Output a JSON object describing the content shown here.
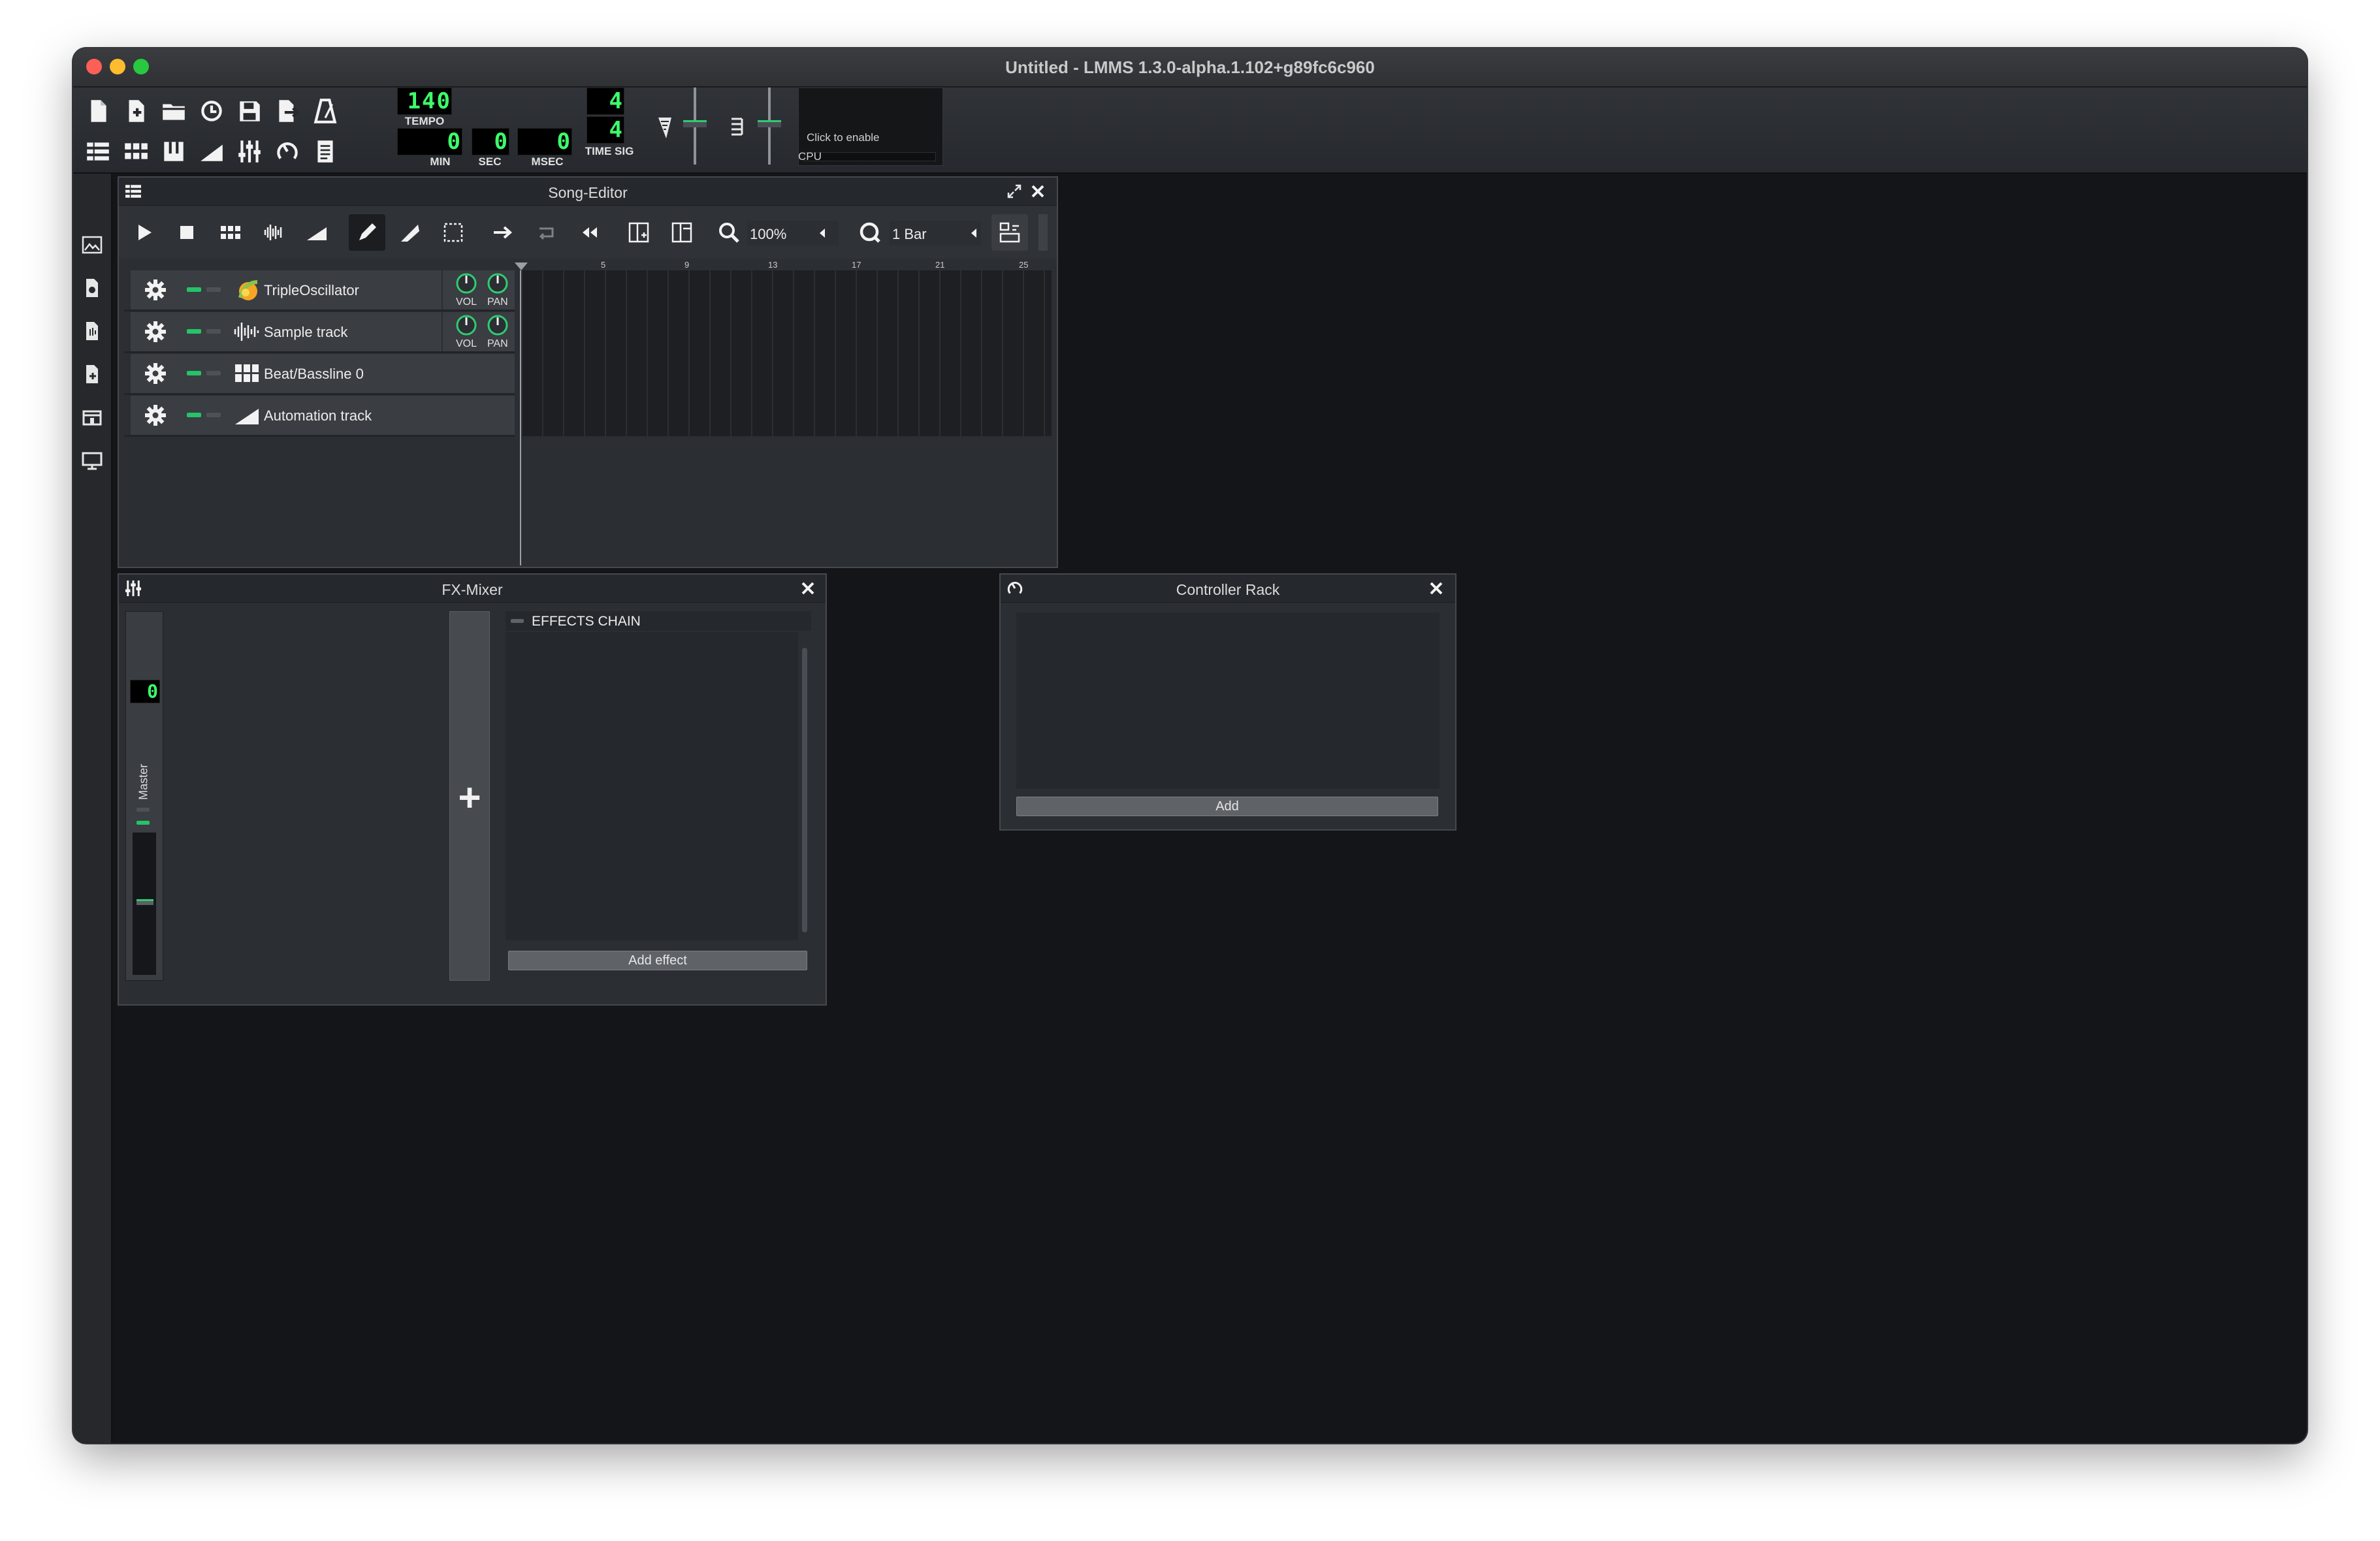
{
  "window": {
    "title": "Untitled - LMMS 1.3.0-alpha.1.102+g89fc6c960",
    "traffic_colors": [
      "#fe5f57",
      "#febc2e",
      "#28c840"
    ]
  },
  "toolbar": {
    "row1_icons": [
      "new-file-icon",
      "new-from-template-icon",
      "open-folder-icon",
      "recent-projects-icon",
      "save-icon",
      "export-icon",
      "metronome-icon"
    ],
    "row2_icons": [
      "song-editor-icon",
      "beat-bassline-icon",
      "piano-roll-icon",
      "automation-editor-icon",
      "fx-mixer-icon",
      "controller-rack-icon",
      "project-notes-icon"
    ],
    "tempo": {
      "value": "140",
      "label": "TEMPO"
    },
    "time": {
      "min_value": "0",
      "min_label": "MIN",
      "sec_value": "0",
      "sec_label": "SEC",
      "msec_value": "0",
      "msec_label": "MSEC"
    },
    "time_sig": {
      "numerator": "4",
      "denominator": "4",
      "label": "TIME SIG"
    },
    "cpu": {
      "hint": "Click to enable",
      "label": "CPU"
    }
  },
  "sidebar": {
    "icons": [
      "instrument-plugins-icon",
      "my-projects-icon",
      "my-samples-icon",
      "my-presets-icon",
      "my-home-icon",
      "root-directory-icon"
    ]
  },
  "song_editor": {
    "title": "Song-Editor",
    "zoom": "100%",
    "quantize": "1 Bar",
    "ruler_marks": [
      "5",
      "9",
      "13",
      "17",
      "21",
      "25"
    ],
    "tracks": [
      {
        "name": "TripleOscillator",
        "icon": "triple-oscillator-icon",
        "vol_label": "VOL",
        "pan_label": "PAN"
      },
      {
        "name": "Sample track",
        "icon": "sample-track-icon",
        "vol_label": "VOL",
        "pan_label": "PAN"
      },
      {
        "name": "Beat/Bassline 0",
        "icon": "beat-bassline-track-icon"
      },
      {
        "name": "Automation track",
        "icon": "automation-track-icon"
      }
    ]
  },
  "fx_mixer": {
    "title": "FX-Mixer",
    "channel_number": "0",
    "master_label": "Master",
    "effects_chain_label": "EFFECTS CHAIN",
    "add_effect_label": "Add effect",
    "add_channel_symbol": "+"
  },
  "controller_rack": {
    "title": "Controller Rack",
    "add_label": "Add"
  },
  "colors": {
    "lcd_green": "#3cff6a",
    "led_green": "#25c36a",
    "knob_green": "#2ecc71",
    "workspace": "#131518"
  }
}
